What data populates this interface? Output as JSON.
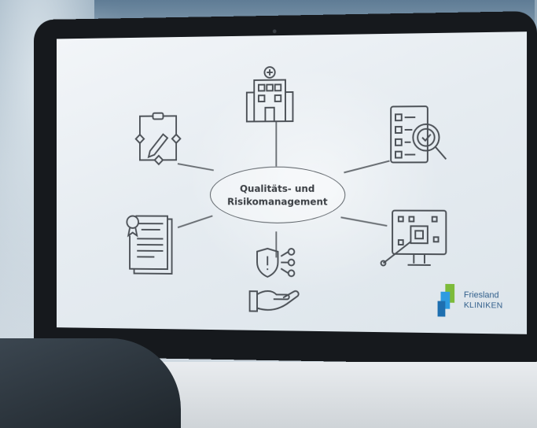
{
  "center_label": [
    "Qualitäts- und",
    "Risikomanagement"
  ],
  "logo": {
    "line1": "Friesland",
    "line2": "KLINIKEN"
  },
  "icons": [
    "hospital-icon",
    "checklist-magnifier-icon",
    "monitor-target-icon",
    "hand-shield-network-icon",
    "certificate-icon",
    "process-edit-icon"
  ],
  "colors": {
    "bezel": "#16191d",
    "screen": "#eef2f5",
    "line": "#6a6f74",
    "logo_green": "#7dbb3a",
    "logo_blue": "#1e88c8"
  }
}
